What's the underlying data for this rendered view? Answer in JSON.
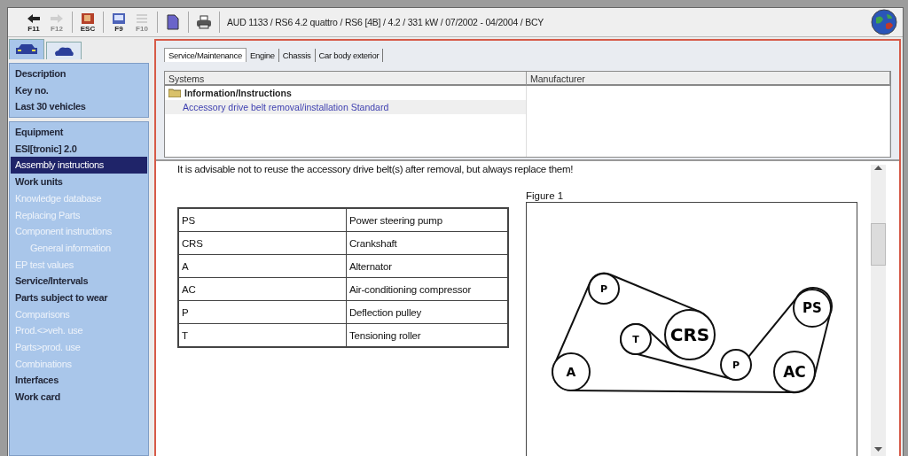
{
  "toolbar": {
    "groups": [
      {
        "buttons": [
          {
            "kind": "back",
            "key": "F11",
            "disabled": false
          },
          {
            "kind": "forward",
            "key": "F12",
            "disabled": true
          }
        ]
      },
      {
        "buttons": [
          {
            "kind": "esc",
            "key": "ESC",
            "disabled": false
          }
        ]
      },
      {
        "buttons": [
          {
            "kind": "screen",
            "key": "F9",
            "disabled": false
          },
          {
            "kind": "list",
            "key": "F10",
            "disabled": true
          }
        ]
      },
      {
        "buttons": [
          {
            "kind": "document",
            "disabled": false
          }
        ]
      },
      {
        "buttons": [
          {
            "kind": "print",
            "disabled": false
          }
        ]
      }
    ],
    "vehicle": "AUD 1133 / RS6 4.2 quattro / RS6 [4B] / 4.2 / 331 kW / 07/2002 - 04/2004 / BCY"
  },
  "sidebar": {
    "tabs": [
      {
        "kind": "car",
        "selected": true
      },
      {
        "kind": "cloud",
        "selected": false
      }
    ],
    "groups": [
      {
        "items": [
          {
            "label": "Description",
            "disabled": false,
            "selected": false
          },
          {
            "label": "Key no.",
            "disabled": false,
            "selected": false
          },
          {
            "label": "Last 30 vehicles",
            "disabled": false,
            "selected": false
          }
        ]
      },
      {
        "items": [
          {
            "label": "Equipment",
            "disabled": false,
            "selected": false
          },
          {
            "label": "ESI[tronic] 2.0",
            "disabled": false,
            "selected": false
          },
          {
            "label": "Assembly instructions",
            "disabled": false,
            "selected": true
          },
          {
            "label": "Work units",
            "disabled": false,
            "selected": false
          },
          {
            "label": "Knowledge database",
            "disabled": true,
            "selected": false
          },
          {
            "label": "Replacing Parts",
            "disabled": true,
            "selected": false
          },
          {
            "label": "Component instructions",
            "disabled": true,
            "selected": false,
            "children": [
              {
                "label": "General information",
                "disabled": true,
                "selected": false
              }
            ]
          },
          {
            "label": "EP test values",
            "disabled": true,
            "selected": false
          },
          {
            "label": "Service/Intervals",
            "disabled": false,
            "selected": false
          },
          {
            "label": "Parts subject to wear",
            "disabled": false,
            "selected": false
          },
          {
            "label": "Comparisons",
            "disabled": true,
            "selected": false
          },
          {
            "label": "Prod.<>veh. use",
            "disabled": true,
            "selected": false
          },
          {
            "label": "Parts>prod. use",
            "disabled": true,
            "selected": false
          },
          {
            "label": "Combinations",
            "disabled": true,
            "selected": false
          },
          {
            "label": "Interfaces",
            "disabled": false,
            "selected": false
          },
          {
            "label": "Work card",
            "disabled": false,
            "selected": false
          }
        ]
      }
    ]
  },
  "tabs": [
    {
      "label": "Service/Maintenance",
      "selected": true
    },
    {
      "label": "Engine",
      "selected": false
    },
    {
      "label": "Chassis",
      "selected": false
    },
    {
      "label": "Car body exterior",
      "selected": false
    }
  ],
  "systems_table": {
    "columns": [
      "Systems",
      "Manufacturer"
    ],
    "rows": [
      {
        "kind": "folder",
        "label": "Information/Instructions",
        "children": [
          {
            "kind": "document",
            "label": "Accessory drive belt removal/installation Standard"
          }
        ]
      }
    ]
  },
  "document": {
    "notice": "It is advisable not to reuse the accessory drive belt(s) after removal, but always replace them!",
    "legend": [
      {
        "code": "PS",
        "meaning": "Power steering pump"
      },
      {
        "code": "CRS",
        "meaning": "Crankshaft"
      },
      {
        "code": "A",
        "meaning": "Alternator"
      },
      {
        "code": "AC",
        "meaning": "Air-conditioning compressor"
      },
      {
        "code": "P",
        "meaning": "Deflection pulley"
      },
      {
        "code": "T",
        "meaning": "Tensioning roller"
      }
    ],
    "figure": {
      "caption": "Figure 1",
      "pulleys": [
        "P",
        "PS",
        "T",
        "CRS",
        "P",
        "A",
        "AC"
      ]
    }
  }
}
